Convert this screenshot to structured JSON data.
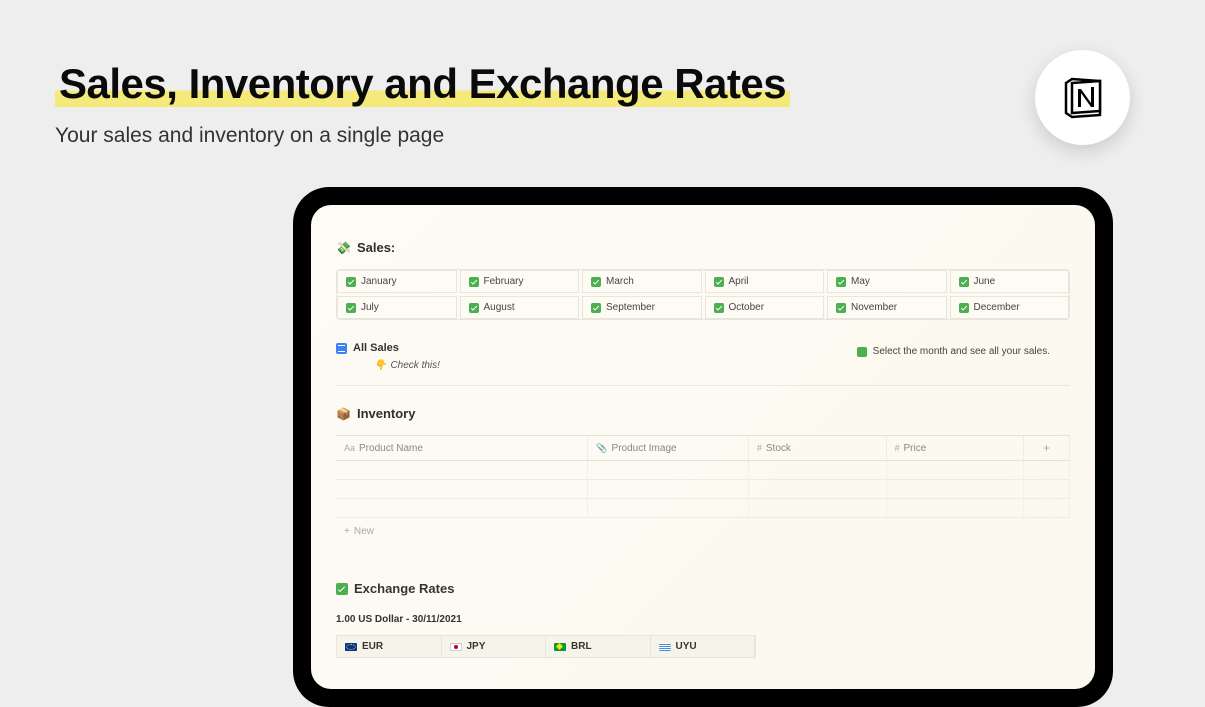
{
  "header": {
    "title": "Sales, Inventory and Exchange Rates",
    "subtitle": "Your sales and inventory on a single page"
  },
  "sales": {
    "title": "Sales:",
    "emoji": "💸",
    "months": [
      "January",
      "February",
      "March",
      "April",
      "May",
      "June",
      "July",
      "August",
      "September",
      "October",
      "November",
      "December"
    ],
    "all_sales_label": "All Sales",
    "check_this": "Check this!",
    "hint": "Select the month and see all your sales."
  },
  "inventory": {
    "title": "Inventory",
    "emoji": "📦",
    "columns": {
      "product_name": "Product Name",
      "product_image": "Product Image",
      "stock": "Stock",
      "price": "Price"
    },
    "new_label": "New"
  },
  "exchange": {
    "title": "Exchange Rates",
    "subtitle": "1.00 US Dollar - 30/11/2021",
    "currencies": [
      "EUR",
      "JPY",
      "BRL",
      "UYU"
    ]
  }
}
